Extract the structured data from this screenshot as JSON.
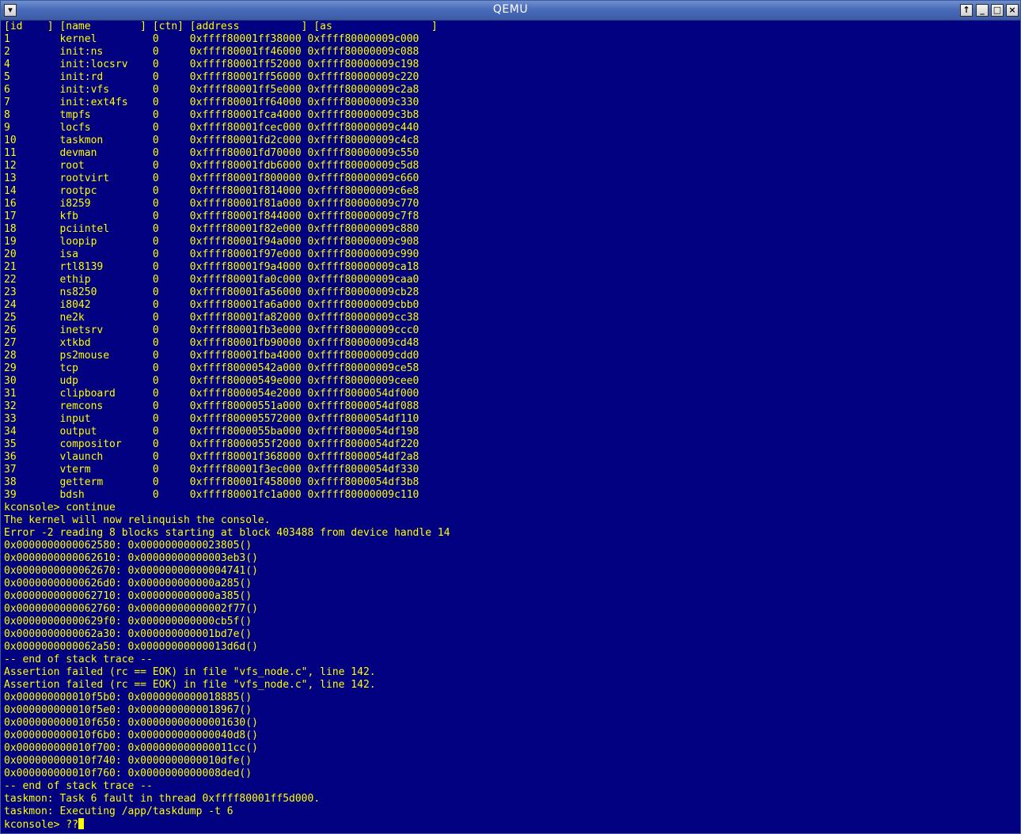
{
  "window": {
    "title": "QEMU",
    "menu_icon": "chevron-down-icon",
    "buttons": {
      "up": "↑",
      "minimize": "_",
      "maximize": "□",
      "close": "×"
    }
  },
  "console": {
    "colors": {
      "background": "#000080",
      "text": "#ffff00"
    },
    "lines": [
      "[id    ] [name        ] [ctn] [address          ] [as                ]",
      "1        kernel         0     0xffff80001ff38000 0xffff80000009c000",
      "2        init:ns        0     0xffff80001ff46000 0xffff80000009c088",
      "4        init:locsrv    0     0xffff80001ff52000 0xffff80000009c198",
      "5        init:rd        0     0xffff80001ff56000 0xffff80000009c220",
      "6        init:vfs       0     0xffff80001ff5e000 0xffff80000009c2a8",
      "7        init:ext4fs    0     0xffff80001ff64000 0xffff80000009c330",
      "8        tmpfs          0     0xffff80001fca4000 0xffff80000009c3b8",
      "9        locfs          0     0xffff80001fcec000 0xffff80000009c440",
      "10       taskmon        0     0xffff80001fd2c000 0xffff80000009c4c8",
      "11       devman         0     0xffff80001fd70000 0xffff80000009c550",
      "12       root           0     0xffff80001fdb6000 0xffff80000009c5d8",
      "13       rootvirt       0     0xffff80001f800000 0xffff80000009c660",
      "14       rootpc         0     0xffff80001f814000 0xffff80000009c6e8",
      "16       i8259          0     0xffff80001f81a000 0xffff80000009c770",
      "17       kfb            0     0xffff80001f844000 0xffff80000009c7f8",
      "18       pciintel       0     0xffff80001f82e000 0xffff80000009c880",
      "19       loopip         0     0xffff80001f94a000 0xffff80000009c908",
      "20       isa            0     0xffff80001f97e000 0xffff80000009c990",
      "21       rtl8139        0     0xffff80001f9a4000 0xffff80000009ca18",
      "22       ethip          0     0xffff80001fa0c000 0xffff80000009caa0",
      "23       ns8250         0     0xffff80001fa56000 0xffff80000009cb28",
      "24       i8042          0     0xffff80001fa6a000 0xffff80000009cbb0",
      "25       ne2k           0     0xffff80001fa82000 0xffff80000009cc38",
      "26       inetsrv        0     0xffff80001fb3e000 0xffff80000009ccc0",
      "27       xtkbd          0     0xffff80001fb90000 0xffff80000009cd48",
      "28       ps2mouse       0     0xffff80001fba4000 0xffff80000009cdd0",
      "29       tcp            0     0xffff80000542a000 0xffff80000009ce58",
      "30       udp            0     0xffff80000549e000 0xffff80000009cee0",
      "31       clipboard      0     0xffff8000054e2000 0xffff8000054df000",
      "32       remcons        0     0xffff80000551a000 0xffff8000054df088",
      "33       input          0     0xffff800005572000 0xffff8000054df110",
      "34       output         0     0xffff8000055ba000 0xffff8000054df198",
      "35       compositor     0     0xffff8000055f2000 0xffff8000054df220",
      "36       vlaunch        0     0xffff80001f368000 0xffff8000054df2a8",
      "37       vterm          0     0xffff80001f3ec000 0xffff8000054df330",
      "38       getterm        0     0xffff80001f458000 0xffff8000054df3b8",
      "39       bdsh           0     0xffff80001fc1a000 0xffff80000009c110",
      "kconsole> continue",
      "The kernel will now relinquish the console.",
      "Error -2 reading 8 blocks starting at block 403488 from device handle 14",
      "0x0000000000062580: 0x0000000000023805()",
      "0x0000000000062610: 0x00000000000003eb3()",
      "0x0000000000062670: 0x00000000000004741()",
      "0x00000000000626d0: 0x000000000000a285()",
      "0x0000000000062710: 0x000000000000a385()",
      "0x0000000000062760: 0x00000000000002f77()",
      "0x00000000000629f0: 0x000000000000cb5f()",
      "0x0000000000062a30: 0x000000000001bd7e()",
      "0x0000000000062a50: 0x00000000000013d6d()",
      "-- end of stack trace --",
      "Assertion failed (rc == EOK) in file \"vfs_node.c\", line 142.",
      "Assertion failed (rc == EOK) in file \"vfs_node.c\", line 142.",
      "0x000000000010f5b0: 0x0000000000018885()",
      "0x000000000010f5e0: 0x0000000000018967()",
      "0x000000000010f650: 0x00000000000001630()",
      "0x000000000010f6b0: 0x000000000000040d8()",
      "0x000000000010f700: 0x000000000000011cc()",
      "0x000000000010f740: 0x0000000000010dfe()",
      "0x000000000010f760: 0x0000000000008ded()",
      "-- end of stack trace --",
      "taskmon: Task 6 fault in thread 0xffff80001ff5d000.",
      "taskmon: Executing /app/taskdump -t 6"
    ],
    "prompt": "kconsole> ??"
  }
}
